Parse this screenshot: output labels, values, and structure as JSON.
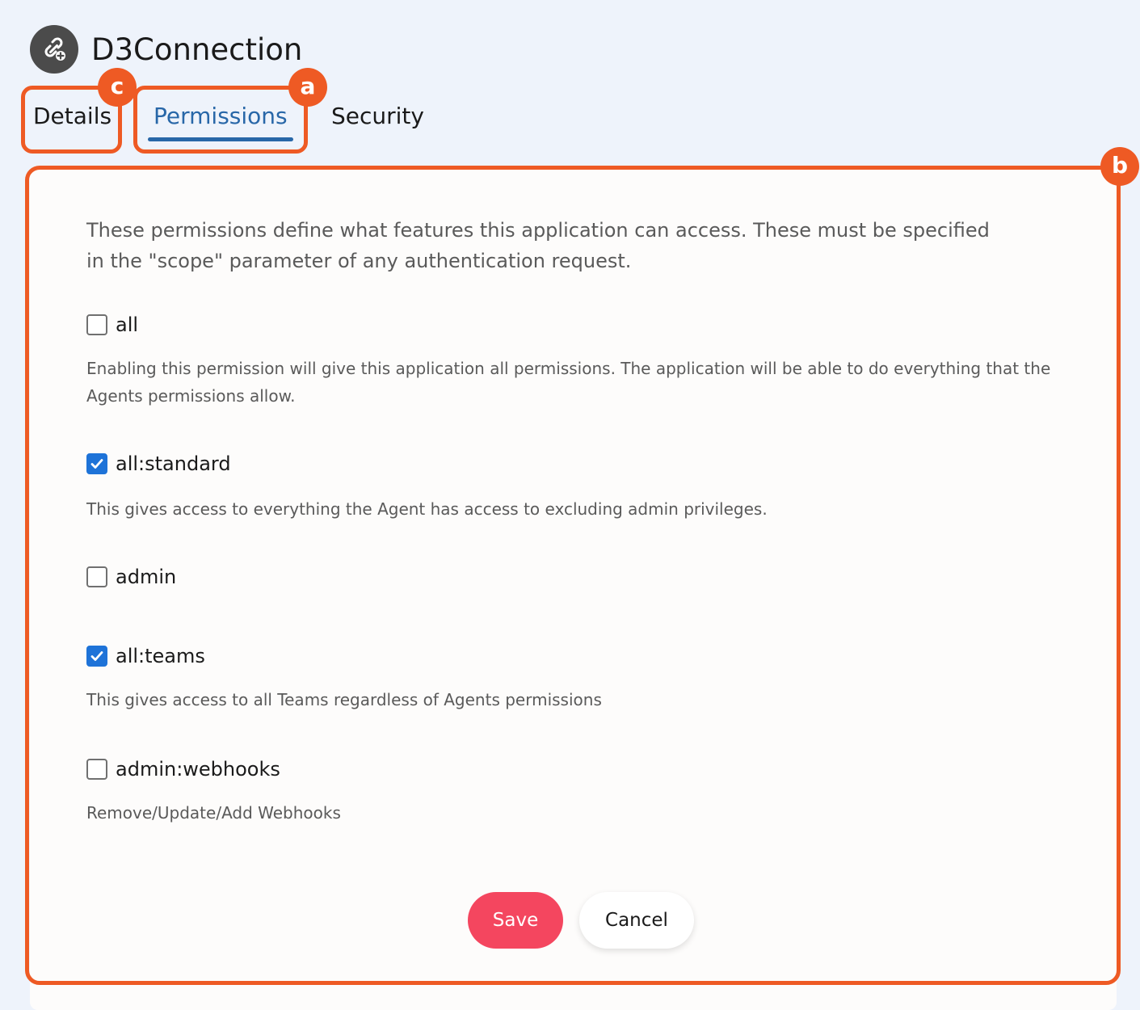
{
  "app": {
    "title": "D3Connection",
    "icon": "link-add-icon"
  },
  "tabs": [
    {
      "label": "Details",
      "active": false
    },
    {
      "label": "Permissions",
      "active": true
    },
    {
      "label": "Security",
      "active": false
    }
  ],
  "intro": "These permissions define what features this application can access. These must be specified in the \"scope\" parameter of any authentication request.",
  "permissions": [
    {
      "label": "all",
      "checked": false,
      "description": "Enabling this permission will give this application all permissions. The application will be able to do everything that the Agents permissions allow."
    },
    {
      "label": "all:standard",
      "checked": true,
      "description": "This gives access to everything the Agent has access to excluding admin privileges."
    },
    {
      "label": "admin",
      "checked": false,
      "description": ""
    },
    {
      "label": "all:teams",
      "checked": true,
      "description": "This gives access to all Teams regardless of Agents permissions"
    },
    {
      "label": "admin:webhooks",
      "checked": false,
      "description": "Remove/Update/Add Webhooks"
    }
  ],
  "actions": {
    "save_label": "Save",
    "cancel_label": "Cancel"
  },
  "annotations": {
    "a": "a",
    "b": "b",
    "c": "c"
  },
  "colors": {
    "accent": "#2867a8",
    "checkbox_checked": "#1e73d8",
    "save_button": "#f4465f",
    "annotation": "#ee5a24",
    "page_background": "#eef3fb"
  }
}
